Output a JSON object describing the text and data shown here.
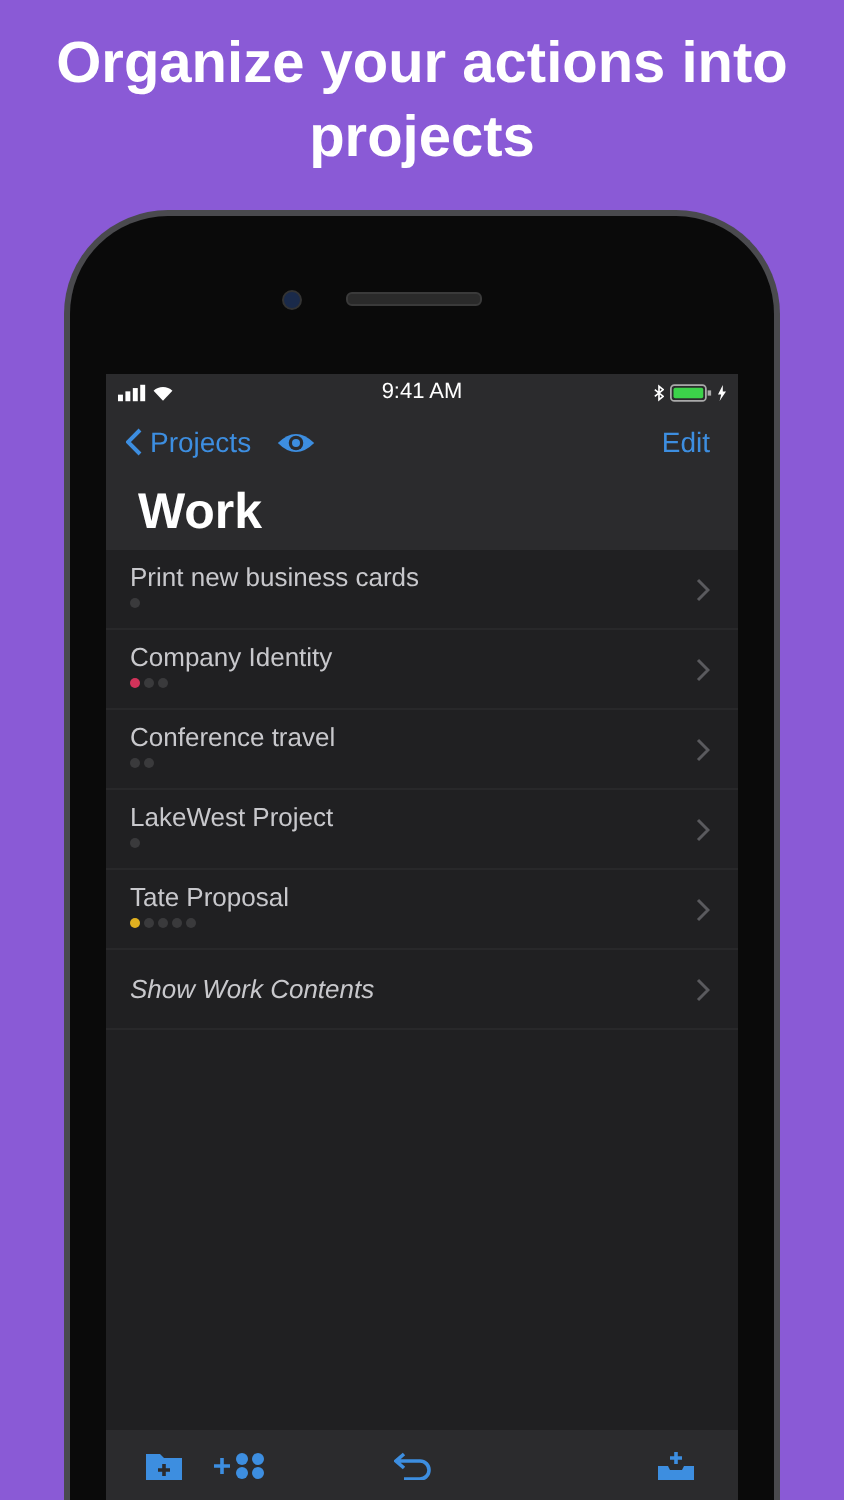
{
  "headline": "Organize your actions into projects",
  "status_bar": {
    "time": "9:41 AM"
  },
  "nav": {
    "back": "Projects",
    "edit": "Edit"
  },
  "title": "Work",
  "rows": [
    {
      "kind": "project",
      "label": "Print new business cards",
      "dots": [
        {
          "color": "#3a3a3c"
        }
      ]
    },
    {
      "kind": "project",
      "label": "Company Identity",
      "dots": [
        {
          "color": "#d2335a"
        },
        {
          "color": "#3a3a3c"
        },
        {
          "color": "#3a3a3c"
        }
      ]
    },
    {
      "kind": "project",
      "label": "Conference travel",
      "dots": [
        {
          "color": "#3a3a3c"
        },
        {
          "color": "#3a3a3c"
        }
      ]
    },
    {
      "kind": "project",
      "label": "LakeWest Project",
      "dots": [
        {
          "color": "#3a3a3c"
        }
      ]
    },
    {
      "kind": "project",
      "label": "Tate Proposal",
      "dots": [
        {
          "color": "#e0b020"
        },
        {
          "color": "#3a3a3c"
        },
        {
          "color": "#3a3a3c"
        },
        {
          "color": "#3a3a3c"
        },
        {
          "color": "#3a3a3c"
        }
      ]
    },
    {
      "kind": "link",
      "label": "Show Work Contents"
    }
  ]
}
